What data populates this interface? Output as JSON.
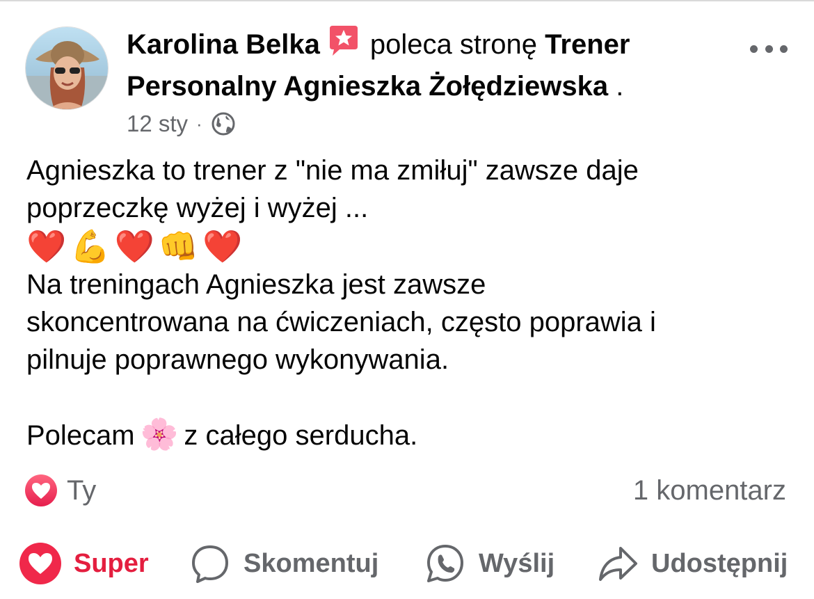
{
  "post": {
    "author": "Karolina Belka",
    "recommend_icon": "recommendation-star-icon",
    "verb": "poleca stronę",
    "page_name": "Trener Personalny Agnieszka Żołędziewska",
    "page_name_line1": "Trener",
    "page_name_line2": "Personalny Agnieszka Żołędziewska",
    "trailing": ".",
    "date": "12 sty",
    "separator": "·",
    "privacy_icon": "globe-icon",
    "body": {
      "line1": "Agnieszka to trener z \"nie ma zmiłuj\" zawsze daje",
      "line2": "poprzeczkę wyżej i wyżej ...",
      "emojis": [
        "❤️",
        "💪",
        "❤️",
        "👊",
        "❤️"
      ],
      "line3": "Na treningach Agnieszka jest zawsze",
      "line4": "skoncentrowana na ćwiczeniach, często poprawia i",
      "line5": "pilnuje poprawnego wykonywania.",
      "closing_start": "Polecam",
      "closing_emoji": "🌸",
      "closing_end": "z całego serducha."
    }
  },
  "reactions": {
    "icon": "love-reaction-icon",
    "label": "Ty",
    "comments": "1 komentarz"
  },
  "actions": {
    "super": "Super",
    "comment": "Skomentuj",
    "send": "Wyślij",
    "share": "Udostępnij"
  },
  "colors": {
    "love_red": "#e41e3f",
    "secondary_text": "#65676b",
    "recommend_pink": "#f25268"
  }
}
